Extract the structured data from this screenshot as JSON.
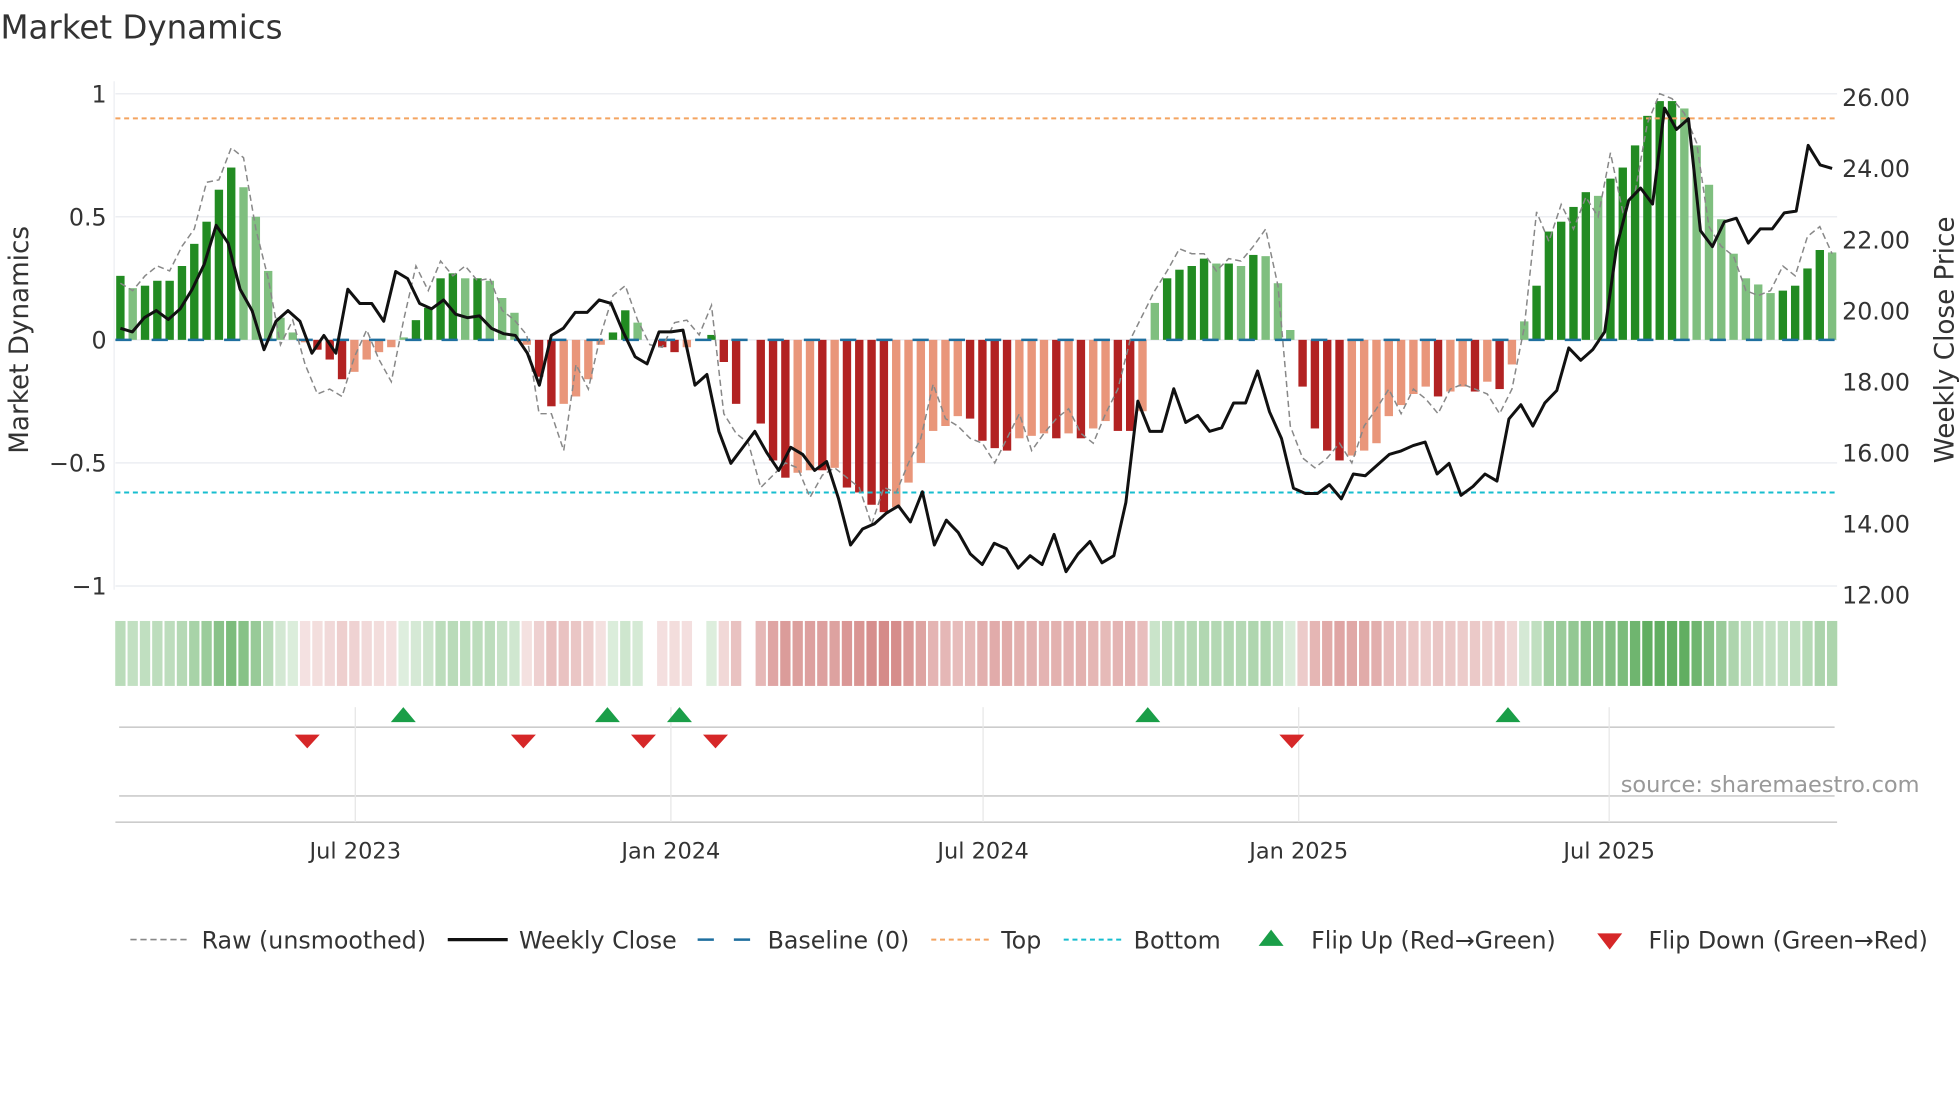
{
  "chart_data": {
    "type": "bar",
    "title": "Market Dynamics",
    "ylabel": "Market Dynamics",
    "y2label": "Weekly Close Price",
    "ylim": [
      -1,
      1
    ],
    "y2lim": [
      12,
      26
    ],
    "yticks": [
      "1",
      "0.5",
      "0",
      "−0.5",
      "−1"
    ],
    "ytick_values": [
      1,
      0.5,
      0,
      -0.5,
      -1
    ],
    "y2ticks": [
      "26.00",
      "24.00",
      "22.00",
      "20.00",
      "18.00",
      "16.00",
      "14.00",
      "12.00"
    ],
    "y2tick_values": [
      26,
      24,
      22,
      20,
      18,
      16,
      14,
      12
    ],
    "xticks": [
      {
        "label": "Jul 2023",
        "date": "2023-07-01"
      },
      {
        "label": "Jan 2024",
        "date": "2024-01-01"
      },
      {
        "label": "Jul 2024",
        "date": "2024-07-01"
      },
      {
        "label": "Jan 2025",
        "date": "2025-01-01"
      },
      {
        "label": "Jul 2025",
        "date": "2025-07-01"
      }
    ],
    "frequency": "weekly",
    "start_date": "2023-02-18",
    "top_level": 0.9,
    "bottom_level": -0.62,
    "baseline": 0,
    "smoothed": [
      0.26,
      0.21,
      0.22,
      0.24,
      0.24,
      0.3,
      0.39,
      0.48,
      0.61,
      0.7,
      0.62,
      0.5,
      0.28,
      0.09,
      0.03,
      -0.01,
      -0.04,
      -0.08,
      -0.16,
      -0.13,
      -0.08,
      -0.05,
      -0.03,
      0.01,
      0.08,
      0.13,
      0.25,
      0.27,
      0.25,
      0.25,
      0.24,
      0.17,
      0.11,
      -0.02,
      -0.15,
      -0.27,
      -0.26,
      -0.23,
      -0.16,
      -0.02,
      0.03,
      0.12,
      0.07,
      0.0,
      -0.03,
      -0.05,
      -0.03,
      0.0,
      0.02,
      -0.09,
      -0.26,
      0.0,
      -0.34,
      -0.49,
      -0.56,
      -0.54,
      -0.53,
      -0.53,
      -0.52,
      -0.6,
      -0.62,
      -0.67,
      -0.7,
      -0.68,
      -0.58,
      -0.5,
      -0.37,
      -0.35,
      -0.31,
      -0.32,
      -0.41,
      -0.44,
      -0.45,
      -0.4,
      -0.39,
      -0.38,
      -0.4,
      -0.38,
      -0.4,
      -0.36,
      -0.33,
      -0.37,
      -0.37,
      -0.29,
      0.15,
      0.25,
      0.285,
      0.3,
      0.33,
      0.31,
      0.31,
      0.3,
      0.345,
      0.34,
      0.23,
      0.04,
      -0.19,
      -0.36,
      -0.45,
      -0.49,
      -0.47,
      -0.45,
      -0.42,
      -0.31,
      -0.265,
      -0.22,
      -0.19,
      -0.23,
      -0.21,
      -0.19,
      -0.21,
      -0.17,
      -0.2,
      -0.1,
      0.075,
      0.22,
      0.44,
      0.48,
      0.54,
      0.6,
      0.585,
      0.655,
      0.7,
      0.79,
      0.91,
      0.97,
      0.97,
      0.94,
      0.79,
      0.63,
      0.49,
      0.35,
      0.25,
      0.225,
      0.19,
      0.2,
      0.22,
      0.29,
      0.365,
      0.355
    ],
    "raw": [
      0.23,
      0.2,
      0.26,
      0.3,
      0.28,
      0.38,
      0.45,
      0.64,
      0.65,
      0.78,
      0.74,
      0.45,
      0.25,
      -0.02,
      0.08,
      -0.1,
      -0.22,
      -0.2,
      -0.23,
      -0.07,
      0.04,
      -0.08,
      -0.17,
      0.08,
      0.3,
      0.2,
      0.32,
      0.26,
      0.3,
      0.24,
      0.25,
      0.12,
      0.08,
      0.02,
      -0.3,
      -0.3,
      -0.45,
      -0.1,
      -0.2,
      0.02,
      0.18,
      0.22,
      0.08,
      -0.02,
      -0.03,
      0.07,
      0.08,
      0.02,
      0.14,
      -0.3,
      -0.38,
      -0.42,
      -0.6,
      -0.55,
      -0.5,
      -0.52,
      -0.64,
      -0.55,
      -0.52,
      -0.56,
      -0.6,
      -0.75,
      -0.6,
      -0.62,
      -0.5,
      -0.4,
      -0.18,
      -0.32,
      -0.35,
      -0.4,
      -0.42,
      -0.5,
      -0.4,
      -0.3,
      -0.45,
      -0.38,
      -0.32,
      -0.28,
      -0.38,
      -0.42,
      -0.3,
      -0.2,
      0.0,
      0.1,
      0.2,
      0.28,
      0.37,
      0.35,
      0.35,
      0.28,
      0.33,
      0.32,
      0.38,
      0.45,
      0.22,
      -0.35,
      -0.48,
      -0.52,
      -0.48,
      -0.42,
      -0.5,
      -0.35,
      -0.28,
      -0.2,
      -0.3,
      -0.2,
      -0.24,
      -0.3,
      -0.2,
      -0.18,
      -0.2,
      -0.22,
      -0.3,
      -0.2,
      0.05,
      0.52,
      0.4,
      0.55,
      0.45,
      0.58,
      0.5,
      0.76,
      0.52,
      0.6,
      0.88,
      1.0,
      0.98,
      0.92,
      0.8,
      0.46,
      0.38,
      0.34,
      0.2,
      0.18,
      0.2,
      0.3,
      0.26,
      0.42,
      0.46,
      0.35
    ],
    "weekly_close": [
      19.5,
      19.4,
      19.8,
      20.0,
      19.75,
      20.05,
      20.6,
      21.3,
      22.4,
      21.9,
      20.6,
      20.0,
      18.9,
      19.7,
      20.0,
      19.7,
      18.8,
      19.3,
      18.8,
      20.6,
      20.2,
      20.2,
      19.7,
      21.1,
      20.9,
      20.2,
      20.05,
      20.3,
      19.9,
      19.8,
      19.85,
      19.5,
      19.35,
      19.3,
      18.8,
      17.9,
      19.3,
      19.5,
      19.95,
      19.95,
      20.3,
      20.2,
      19.4,
      18.7,
      18.5,
      19.4,
      19.4,
      19.45,
      17.9,
      18.2,
      16.6,
      15.7,
      16.15,
      16.6,
      16.0,
      15.5,
      16.15,
      15.95,
      15.5,
      15.75,
      14.7,
      13.4,
      13.85,
      14.0,
      14.3,
      14.5,
      14.05,
      14.9,
      13.4,
      14.1,
      13.75,
      13.15,
      12.85,
      13.45,
      13.3,
      12.75,
      13.1,
      12.85,
      13.7,
      12.65,
      13.15,
      13.5,
      12.9,
      13.1,
      14.6,
      17.45,
      16.6,
      16.6,
      17.8,
      16.85,
      17.05,
      16.6,
      16.7,
      17.4,
      17.4,
      18.3,
      17.15,
      16.4,
      15.0,
      14.85,
      14.85,
      15.1,
      14.7,
      15.4,
      15.35,
      15.65,
      15.95,
      16.05,
      16.2,
      16.3,
      15.4,
      15.7,
      14.8,
      15.05,
      15.4,
      15.2,
      16.95,
      17.35,
      16.75,
      17.4,
      17.75,
      18.95,
      18.6,
      18.9,
      19.4,
      21.8,
      23.1,
      23.45,
      23.0,
      25.7,
      25.1,
      25.4,
      22.25,
      21.8,
      22.5,
      22.6,
      21.9,
      22.3,
      22.3,
      22.75,
      22.8,
      24.65,
      24.1,
      24.0
    ],
    "flip_up_dates": [
      "2023-07-29",
      "2023-11-25",
      "2024-01-06",
      "2024-10-05",
      "2025-05-03"
    ],
    "flip_down_dates": [
      "2023-06-03",
      "2023-10-07",
      "2023-12-16",
      "2024-01-27",
      "2024-12-28"
    ],
    "colors": {
      "green_strong": "#228b22",
      "green_weak": "#7fbf7f",
      "red_strong": "#b22222",
      "red_weak": "#e9967a",
      "close": "#111111",
      "raw": "#888888",
      "baseline": "#1f6f9f",
      "top": "#f4a460",
      "bottom": "#17becf",
      "flip_up": "#1a9e48",
      "flip_down": "#d62728"
    },
    "legend": {
      "placement": "bottom",
      "items": [
        {
          "label": "Raw (unsmoothed)",
          "kind": "raw"
        },
        {
          "label": "Weekly Close",
          "kind": "close"
        },
        {
          "label": "Baseline (0)",
          "kind": "baseline"
        },
        {
          "label": "Top",
          "kind": "top"
        },
        {
          "label": "Bottom",
          "kind": "bottom"
        },
        {
          "label": "Flip Up (Red→Green)",
          "kind": "up"
        },
        {
          "label": "Flip Down (Green→Red)",
          "kind": "down"
        }
      ]
    },
    "source": "source: sharemaestro.com"
  }
}
